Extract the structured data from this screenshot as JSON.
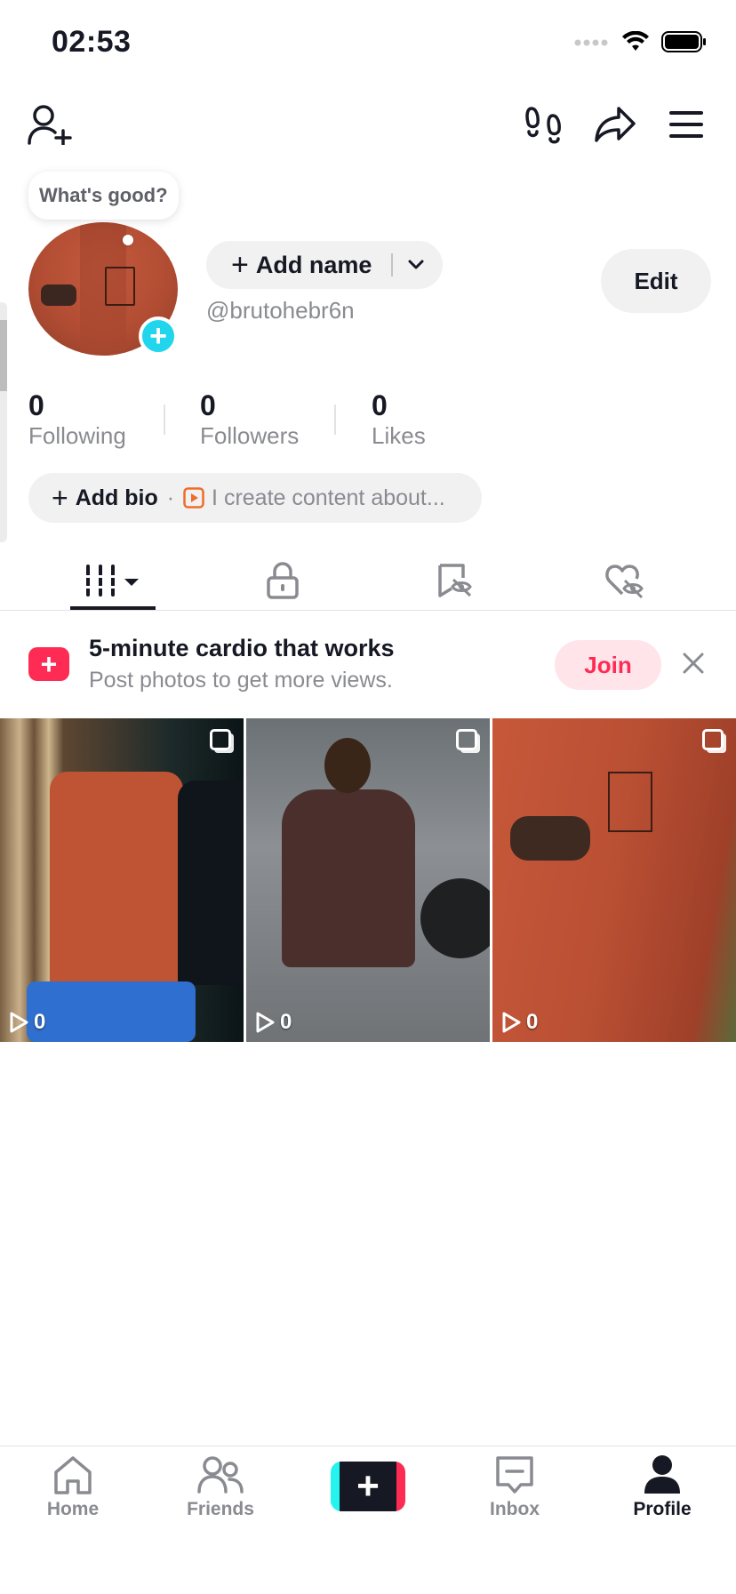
{
  "status_bar": {
    "time": "02:53"
  },
  "profile": {
    "bubble_text": "What's good?",
    "add_name_label": "Add name",
    "username": "@brutohebr6n",
    "edit_label": "Edit",
    "stats": [
      {
        "value": "0",
        "label": "Following"
      },
      {
        "value": "0",
        "label": "Followers"
      },
      {
        "value": "0",
        "label": "Likes"
      }
    ],
    "add_bio_label": "Add bio",
    "bio_separator": "·",
    "bio_placeholder": "I create content about..."
  },
  "tabs": [
    {
      "icon": "grid-videos-icon",
      "active": true
    },
    {
      "icon": "lock-icon"
    },
    {
      "icon": "bookmark-hidden-icon"
    },
    {
      "icon": "heart-hidden-icon"
    }
  ],
  "banner": {
    "title": "5-minute cardio that works",
    "subtitle": "Post photos to get more views.",
    "join_label": "Join"
  },
  "videos": [
    {
      "views": "0"
    },
    {
      "views": "0"
    },
    {
      "views": "0"
    }
  ],
  "bottom_nav": {
    "home": "Home",
    "friends": "Friends",
    "inbox": "Inbox",
    "profile": "Profile"
  },
  "colors": {
    "accent": "#fe2c55",
    "cyan": "#20d5ec",
    "text": "#161823",
    "muted": "#8a8b91"
  }
}
